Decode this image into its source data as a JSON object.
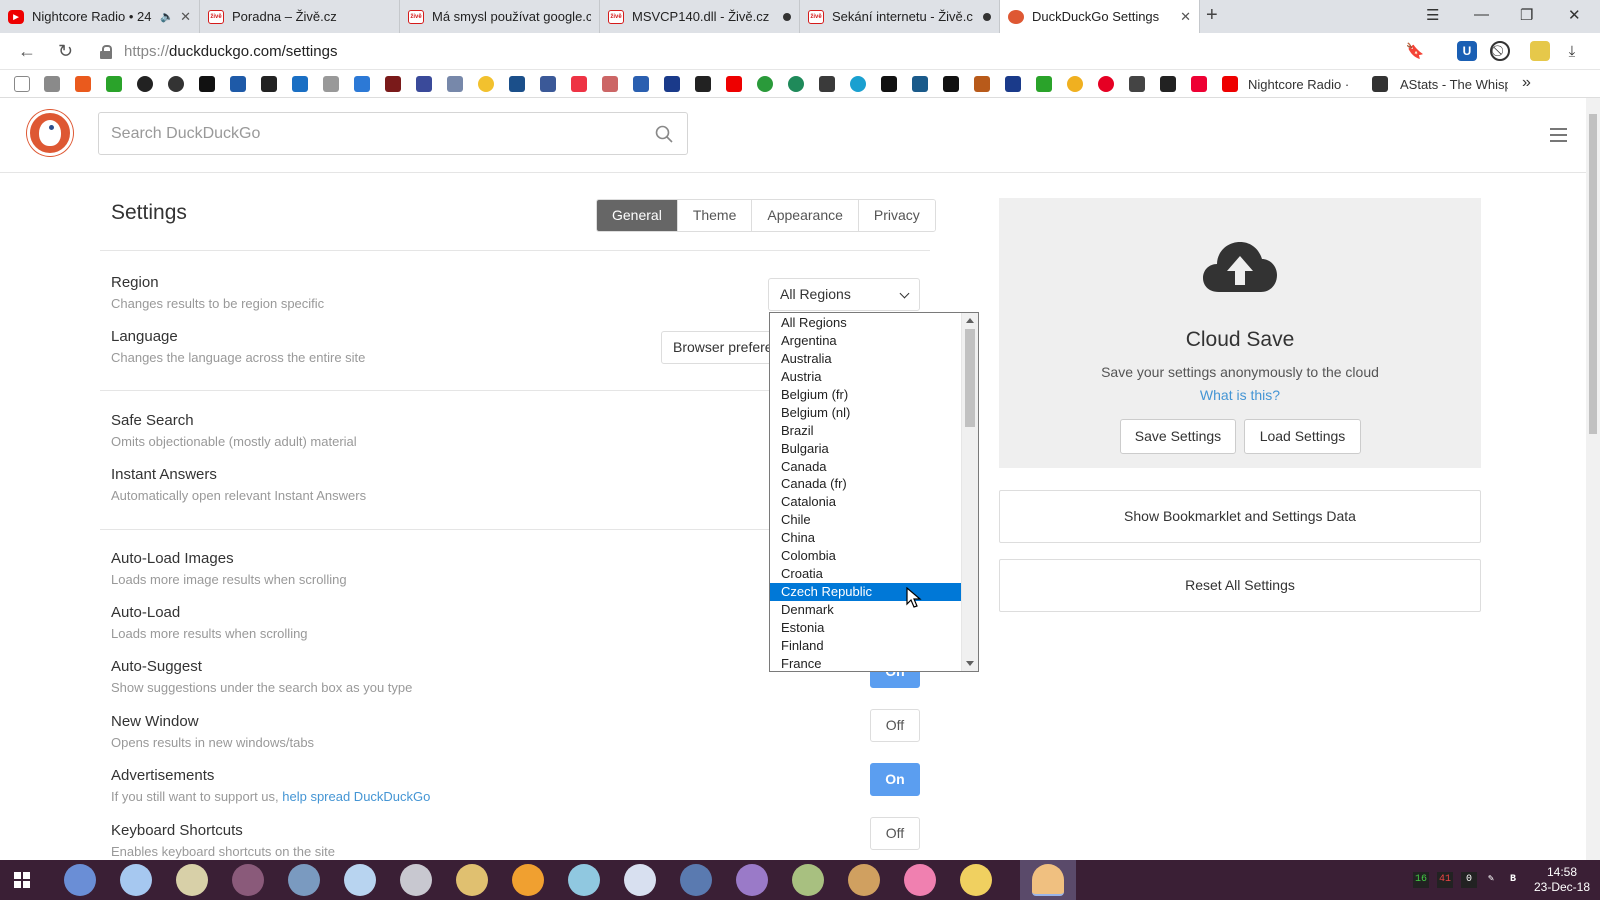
{
  "browser": {
    "tabs": [
      {
        "title": "Nightcore Radio • 24",
        "icon": "youtube-icon",
        "muted_icon": "speaker-icon"
      },
      {
        "title": "Poradna – Živě.cz",
        "icon": "zive-icon"
      },
      {
        "title": "Má smysl používat google.c",
        "icon": "zive-icon"
      },
      {
        "title": "MSVCP140.dll - Živě.cz",
        "icon": "zive-icon"
      },
      {
        "title": "Sekání internetu - Živě.c",
        "icon": "zive-icon"
      },
      {
        "title": "DuckDuckGo Settings",
        "icon": "duckduckgo-icon"
      }
    ],
    "url_scheme": "https://",
    "url_rest": "duckduckgo.com/settings",
    "bookmarks_labels": [
      "Nightcore Radio ·",
      "AStats - The Whisp"
    ]
  },
  "ddg": {
    "search_placeholder": "Search DuckDuckGo"
  },
  "settings": {
    "title": "Settings",
    "tabs": [
      "General",
      "Theme",
      "Appearance",
      "Privacy"
    ],
    "active_tab": "General",
    "rows": [
      {
        "label": "Region",
        "desc": "Changes results to be region specific"
      },
      {
        "label": "Language",
        "desc": "Changes the language across the entire site"
      },
      {
        "label": "Safe Search",
        "desc": "Omits objectionable (mostly adult) material"
      },
      {
        "label": "Instant Answers",
        "desc": "Automatically open relevant Instant Answers"
      },
      {
        "label": "Auto-Load Images",
        "desc": "Loads more image results when scrolling"
      },
      {
        "label": "Auto-Load",
        "desc": "Loads more results when scrolling"
      },
      {
        "label": "Auto-Suggest",
        "desc": "Show suggestions under the search box as you type",
        "value": "On"
      },
      {
        "label": "New Window",
        "desc": "Opens results in new windows/tabs",
        "value": "Off"
      },
      {
        "label": "Advertisements",
        "desc_prefix": "If you still want to support us, ",
        "desc_link": "help spread DuckDuckGo",
        "value": "On"
      },
      {
        "label": "Keyboard Shortcuts",
        "desc": "Enables keyboard shortcuts on the site",
        "value": "Off"
      }
    ],
    "region_value": "All Regions",
    "language_value": "Browser preference",
    "region_options": [
      "All Regions",
      "Argentina",
      "Australia",
      "Austria",
      "Belgium (fr)",
      "Belgium (nl)",
      "Brazil",
      "Bulgaria",
      "Canada",
      "Canada (fr)",
      "Catalonia",
      "Chile",
      "China",
      "Colombia",
      "Croatia",
      "Czech Republic",
      "Denmark",
      "Estonia",
      "Finland",
      "France"
    ],
    "region_highlighted": "Czech Republic"
  },
  "cloud": {
    "title": "Cloud Save",
    "desc": "Save your settings anonymously to the cloud",
    "link": "What is this?",
    "save_btn": "Save Settings",
    "load_btn": "Load Settings",
    "bookmarklet_btn": "Show Bookmarklet and Settings Data",
    "reset_btn": "Reset All Settings"
  },
  "taskbar": {
    "tray_values": [
      "16",
      "41",
      "0"
    ],
    "time": "14:58",
    "date": "23-Dec-18"
  },
  "colors": {
    "accent_blue": "#5b9ef0",
    "link_blue": "#4495d4",
    "ddg_orange": "#de5833",
    "select_highlight": "#0078d7"
  }
}
